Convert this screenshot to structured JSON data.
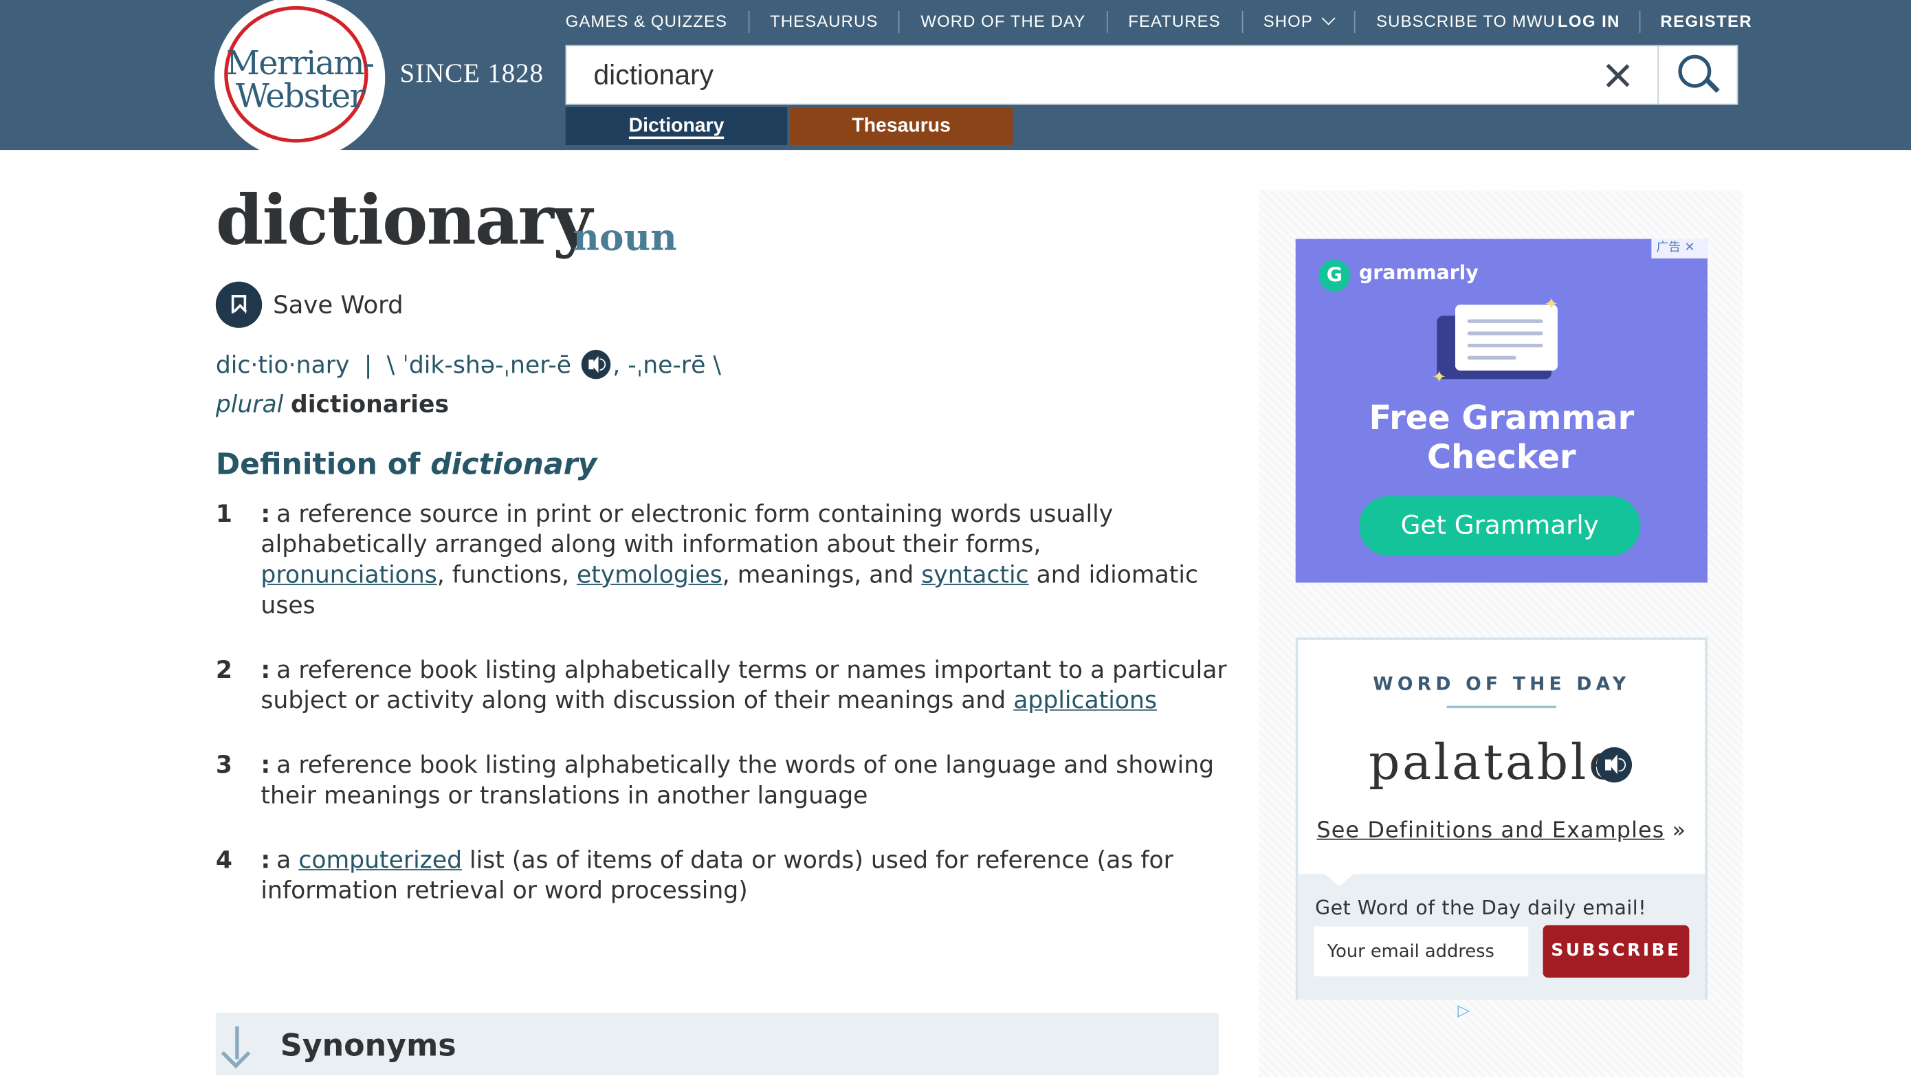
{
  "brand": {
    "logo_line1": "Merriam-",
    "logo_line2": "Webster",
    "since": "SINCE 1828"
  },
  "topnav": {
    "items": [
      "GAMES & QUIZZES",
      "THESAURUS",
      "WORD OF THE DAY",
      "FEATURES",
      "SHOP",
      "SUBSCRIBE TO MWU"
    ],
    "login": "LOG IN",
    "register": "REGISTER"
  },
  "search": {
    "value": "dictionary",
    "tab_dictionary": "Dictionary",
    "tab_thesaurus": "Thesaurus"
  },
  "entry": {
    "headword": "dictionary",
    "pos": "noun",
    "save_label": "Save Word",
    "syllables": "dic·tio·nary",
    "sep": "|",
    "pron1": "\\ ˈdik-shə-ˌner-ē",
    "pron2": ", -ˌne-rē \\",
    "plural_label": "plural",
    "plural_form": "dictionaries",
    "def_title_prefix": "Definition of ",
    "def_title_word": "dictionary",
    "senses": [
      {
        "num": "1",
        "colon": ":",
        "a": "a reference source in print or electronic form containing words usually alphabetically arranged along with information about their forms, ",
        "l1": "pronunciations",
        "b": ", functions, ",
        "l2": "etymologies",
        "c": ", meanings, and ",
        "l3": "syntactic",
        "d": " and idiomatic uses"
      },
      {
        "num": "2",
        "colon": ":",
        "a": "a reference book listing alphabetically terms or names important to a particular subject or activity along with discussion of their meanings and ",
        "l1": "applications"
      },
      {
        "num": "3",
        "colon": ":",
        "a": "a reference book listing alphabetically the words of one language and showing their meanings or translations in another language"
      },
      {
        "num": "4",
        "colon": ":",
        "a": "a ",
        "l1": "computerized",
        "b": " list (as of items of data or words) used for reference (as for information retrieval or word processing)"
      }
    ],
    "synonyms_label": "Synonyms"
  },
  "ad": {
    "badge": "广告 ✕",
    "brand": "grammarly",
    "headline_line1": "Free Grammar",
    "headline_line2": "Checker",
    "cta": "Get Grammarly"
  },
  "wotd": {
    "title": "WORD OF THE DAY",
    "word": "palatable",
    "see_link": "See Definitions and Examples",
    "see_suffix": " »",
    "email_caption": "Get Word of the Day daily email!",
    "email_placeholder": "Your email address",
    "subscribe": "SUBSCRIBE"
  },
  "colors": {
    "header_bg": "#3f5f7a",
    "dictionary_tab": "#1f3f5c",
    "thesaurus_tab": "#8a4417",
    "link": "#265667",
    "ad_bg": "#7a80e8",
    "subscribe_btn": "#a31b23"
  }
}
